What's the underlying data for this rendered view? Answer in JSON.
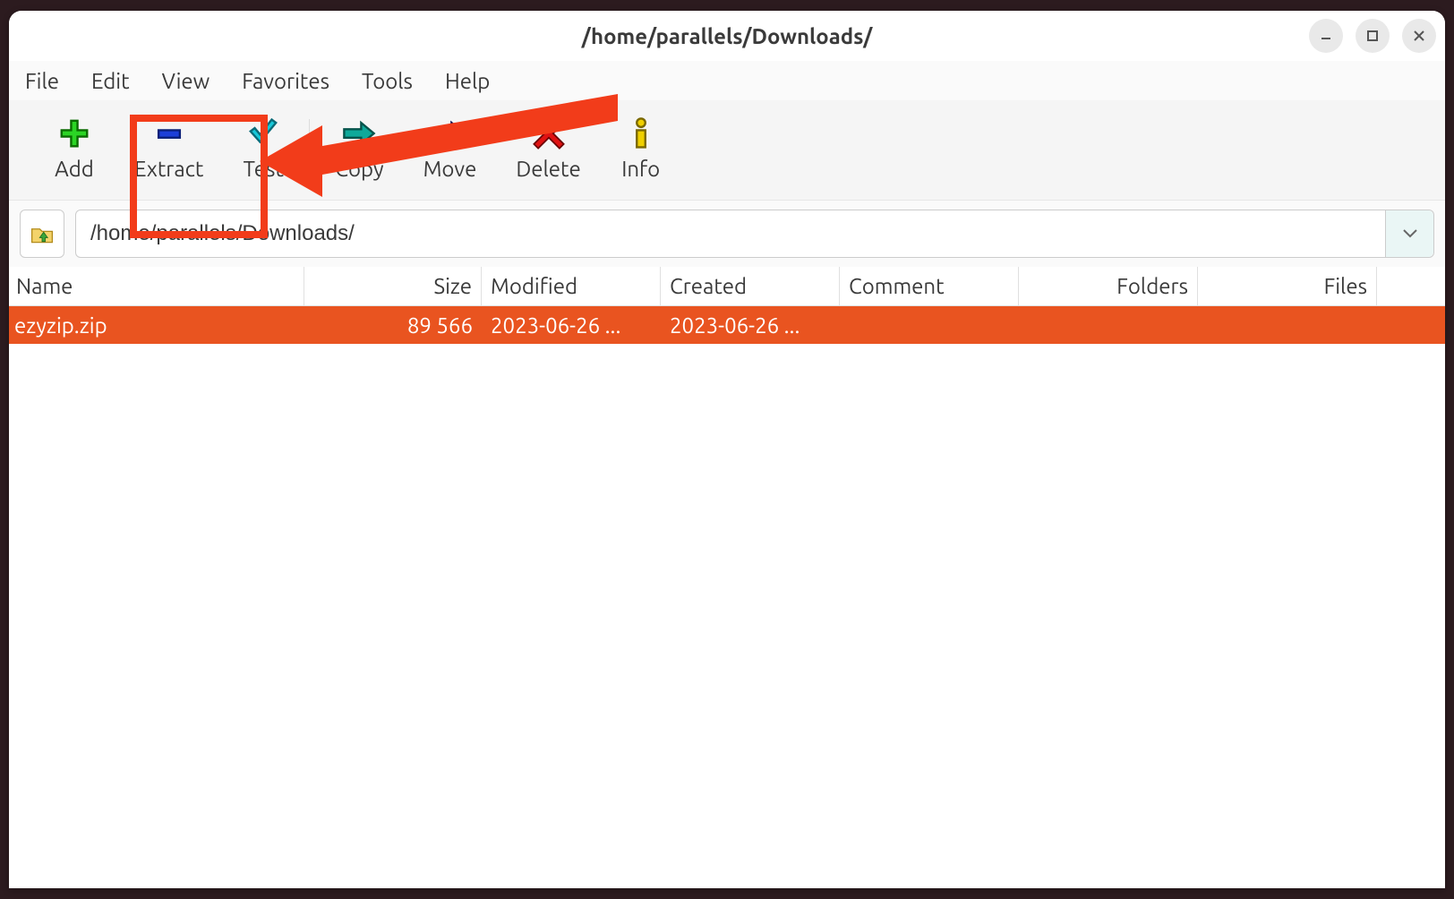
{
  "window": {
    "title": "/home/parallels/Downloads/"
  },
  "menubar": {
    "file": "File",
    "edit": "Edit",
    "view": "View",
    "favorites": "Favorites",
    "tools": "Tools",
    "help": "Help"
  },
  "toolbar": {
    "add": "Add",
    "extract": "Extract",
    "test": "Test",
    "copy": "Copy",
    "move": "Move",
    "delete": "Delete",
    "info": "Info"
  },
  "path": {
    "value": "/home/parallels/Downloads/"
  },
  "columns": {
    "name": "Name",
    "size": "Size",
    "modified": "Modified",
    "created": "Created",
    "comment": "Comment",
    "folders": "Folders",
    "files": "Files"
  },
  "rows": [
    {
      "name": "ezyzip.zip",
      "size": "89 566",
      "modified": "2023-06-26 ...",
      "created": "2023-06-26 ...",
      "comment": "",
      "folders": "",
      "files": ""
    }
  ],
  "annotation": {
    "highlight_target": "extract-button",
    "highlight_color": "#f23c1a"
  }
}
